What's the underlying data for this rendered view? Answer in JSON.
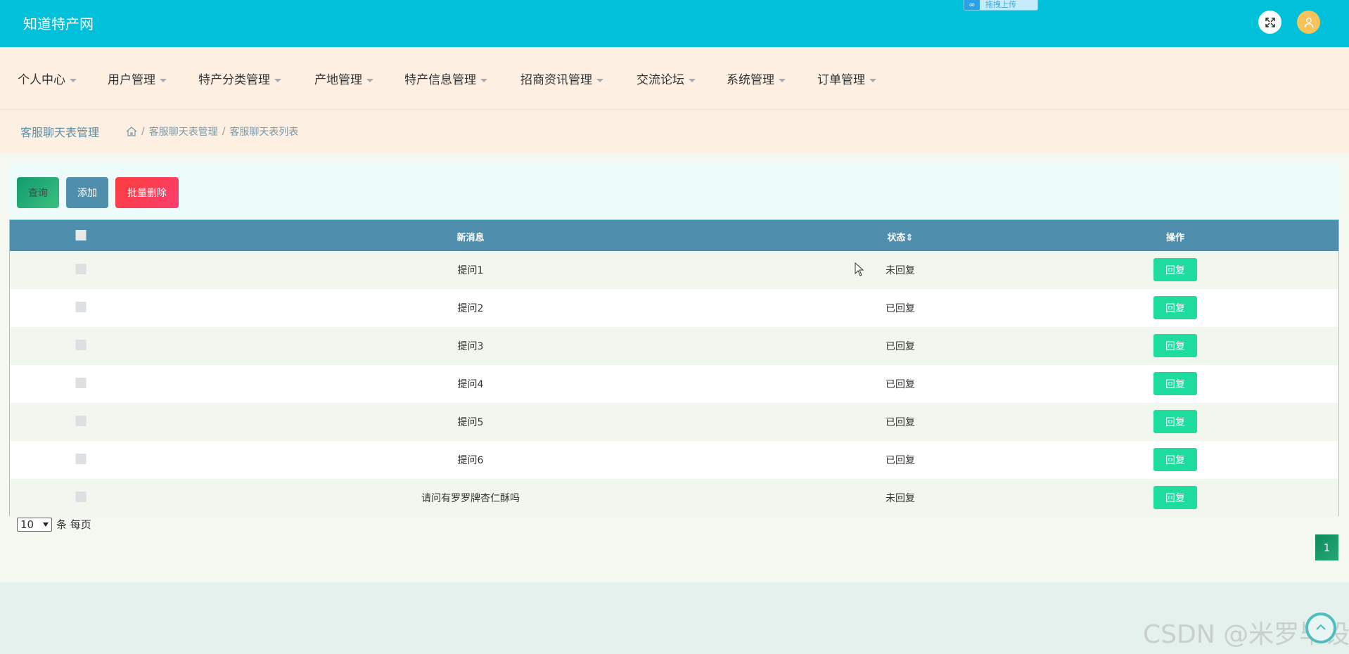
{
  "header": {
    "brand": "知道特产网",
    "upload_chip_label": "拖拽上传",
    "fullscreen_icon": "expand-icon",
    "avatar_icon": "user-icon"
  },
  "nav": {
    "items": [
      {
        "label": "个人中心"
      },
      {
        "label": "用户管理"
      },
      {
        "label": "特产分类管理"
      },
      {
        "label": "产地管理"
      },
      {
        "label": "特产信息管理"
      },
      {
        "label": "招商资讯管理"
      },
      {
        "label": "交流论坛"
      },
      {
        "label": "系统管理"
      },
      {
        "label": "订单管理"
      }
    ]
  },
  "breadcrumb": {
    "title": "客服聊天表管理",
    "items": [
      "客服聊天表管理",
      "客服聊天表列表"
    ],
    "separator": "/"
  },
  "toolbar": {
    "query_label": "查询",
    "add_label": "添加",
    "batch_delete_label": "批量删除"
  },
  "table": {
    "columns": [
      "新消息",
      "状态",
      "操作"
    ],
    "sort_indicator": "⇕",
    "rows": [
      {
        "message": "提问1",
        "status": "未回复",
        "action": "回复"
      },
      {
        "message": "提问2",
        "status": "已回复",
        "action": "回复"
      },
      {
        "message": "提问3",
        "status": "已回复",
        "action": "回复"
      },
      {
        "message": "提问4",
        "status": "已回复",
        "action": "回复"
      },
      {
        "message": "提问5",
        "status": "已回复",
        "action": "回复"
      },
      {
        "message": "提问6",
        "status": "已回复",
        "action": "回复"
      },
      {
        "message": "请问有罗罗牌杏仁酥吗",
        "status": "未回复",
        "action": "回复"
      }
    ]
  },
  "pagination": {
    "page_size": "10",
    "page_size_suffix": "条 每页",
    "current_page": "1"
  },
  "watermark": "CSDN @米罗毕设",
  "colors": {
    "header_bg": "#00c1d9",
    "nav_bg": "#fdf0e3",
    "table_header_bg": "#4f8fad",
    "reply_button": "#1edc9d",
    "delete_button": "#fb3d3d"
  }
}
